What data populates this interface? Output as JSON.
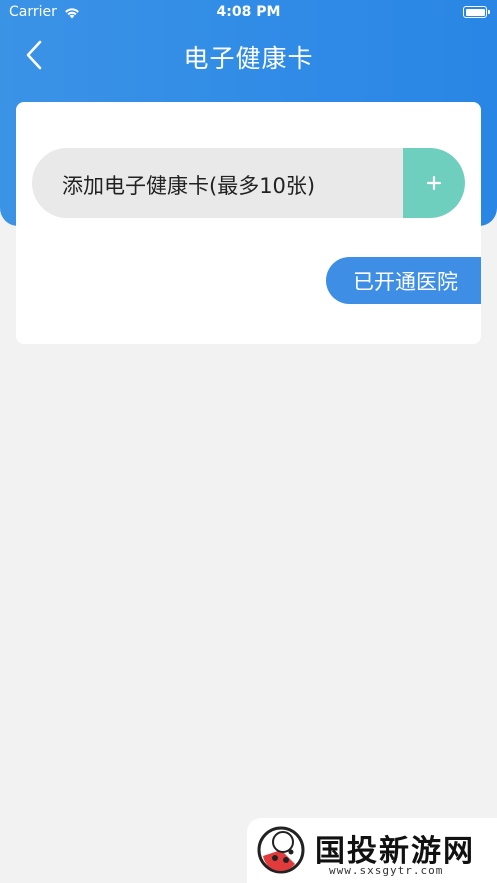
{
  "status_bar": {
    "carrier": "Carrier",
    "time": "4:08 PM"
  },
  "header": {
    "title": "电子健康卡",
    "back_icon": "chevron-left-icon",
    "gradient_color": "#3b93e6"
  },
  "card": {
    "add_label": "添加电子健康卡(最多10张)",
    "add_icon": "plus-icon",
    "add_button_color": "#6ecfbf",
    "hospital_button_label": "已开通医院",
    "hospital_button_color": "#3d8ee4"
  },
  "watermark": {
    "text": "国投新游网",
    "url": "www.sxsgytr.com"
  }
}
